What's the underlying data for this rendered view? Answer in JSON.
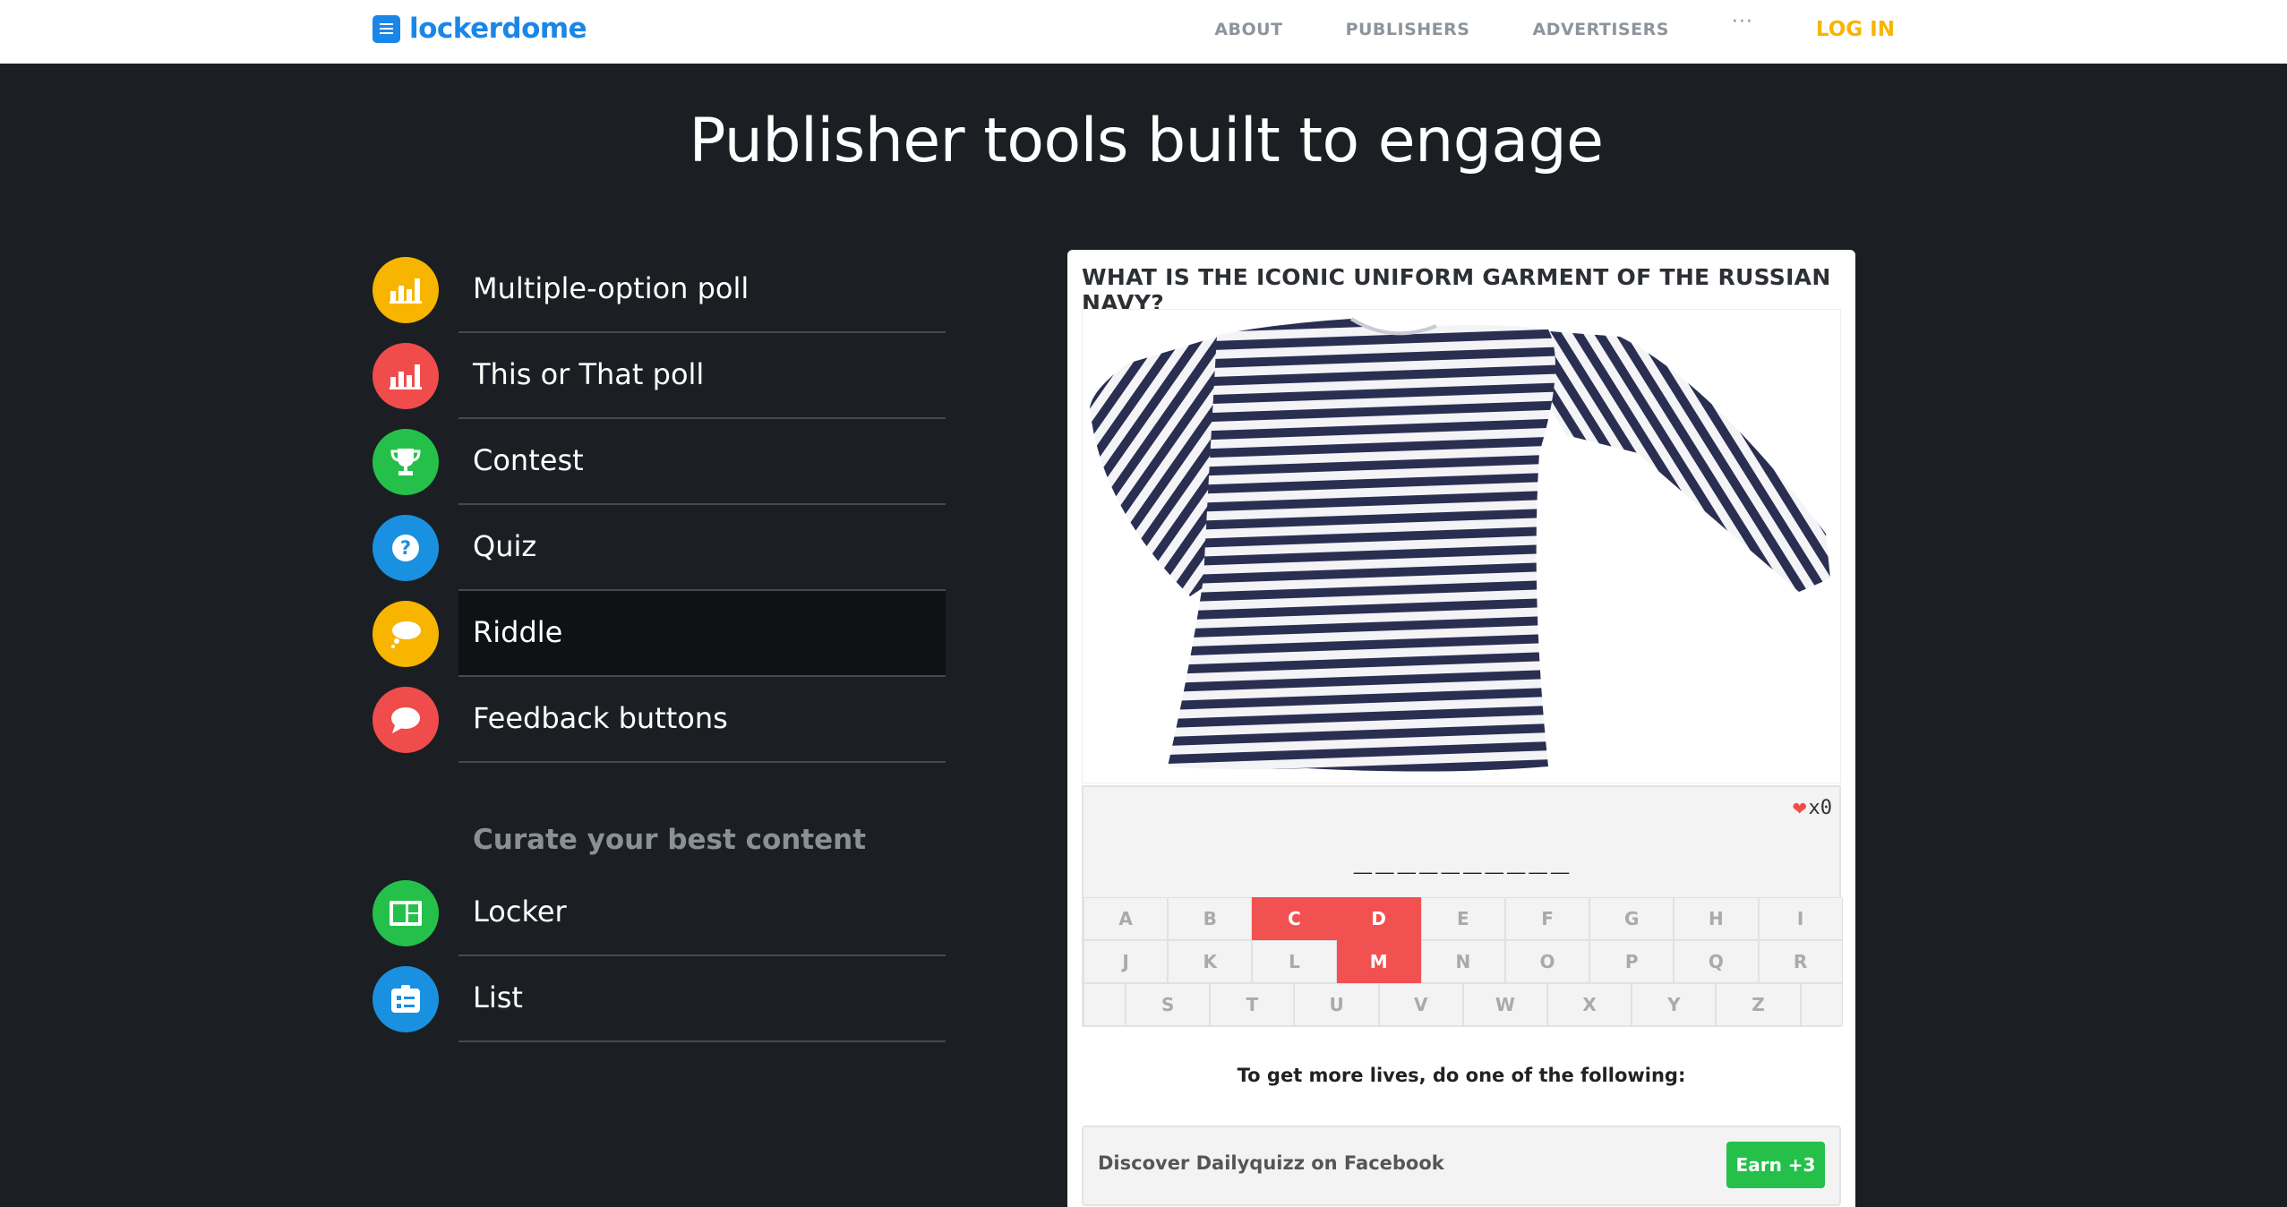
{
  "nav": {
    "logo_text": "lockerdome",
    "about": "ABOUT",
    "publishers": "PUBLISHERS",
    "advertisers": "ADVERTISERS",
    "more": "···",
    "login": "LOG IN"
  },
  "headline": "Publisher tools built to engage",
  "menu": {
    "items": [
      {
        "label": "Multiple-option poll",
        "icon": "bar-chart-icon",
        "color": "#f7b500"
      },
      {
        "label": "This or That poll",
        "icon": "bar-chart-icon",
        "color": "#f14c4c"
      },
      {
        "label": "Contest",
        "icon": "trophy-icon",
        "color": "#25c04a"
      },
      {
        "label": "Quiz",
        "icon": "question-icon",
        "color": "#1a90e0"
      },
      {
        "label": "Riddle",
        "icon": "speech-bubble-icon",
        "color": "#f7b500",
        "active": true
      },
      {
        "label": "Feedback buttons",
        "icon": "chat-bubble-icon",
        "color": "#f14c4c"
      }
    ],
    "section_title": "Curate your best content",
    "curate_items": [
      {
        "label": "Locker",
        "icon": "locker-icon",
        "color": "#25c04a"
      },
      {
        "label": "List",
        "icon": "list-icon",
        "color": "#1a90e0"
      }
    ]
  },
  "riddle": {
    "question": "WHAT IS THE ICONIC UNIFORM GARMENT OF THE RUSSIAN NAVY?",
    "lives_count": "x0",
    "blanks": "__________",
    "keyboard": [
      [
        "A",
        "B",
        "C",
        "D",
        "E",
        "F",
        "G",
        "H",
        "I"
      ],
      [
        "J",
        "K",
        "L",
        "M",
        "N",
        "O",
        "P",
        "Q",
        "R"
      ],
      [
        "S",
        "T",
        "U",
        "V",
        "W",
        "X",
        "Y",
        "Z"
      ]
    ],
    "used_letters": [
      "C",
      "D",
      "M"
    ],
    "lives_prompt": "To get more lives, do one of the following:",
    "offer_text": "Discover Dailyquizz on Facebook",
    "offer_button": "Earn +3"
  },
  "colors": {
    "background": "#1b1f23",
    "brand_blue": "#1a86e8",
    "login_yellow": "#f7b500",
    "used_key_red": "#f15151",
    "earn_green": "#25c04a"
  }
}
